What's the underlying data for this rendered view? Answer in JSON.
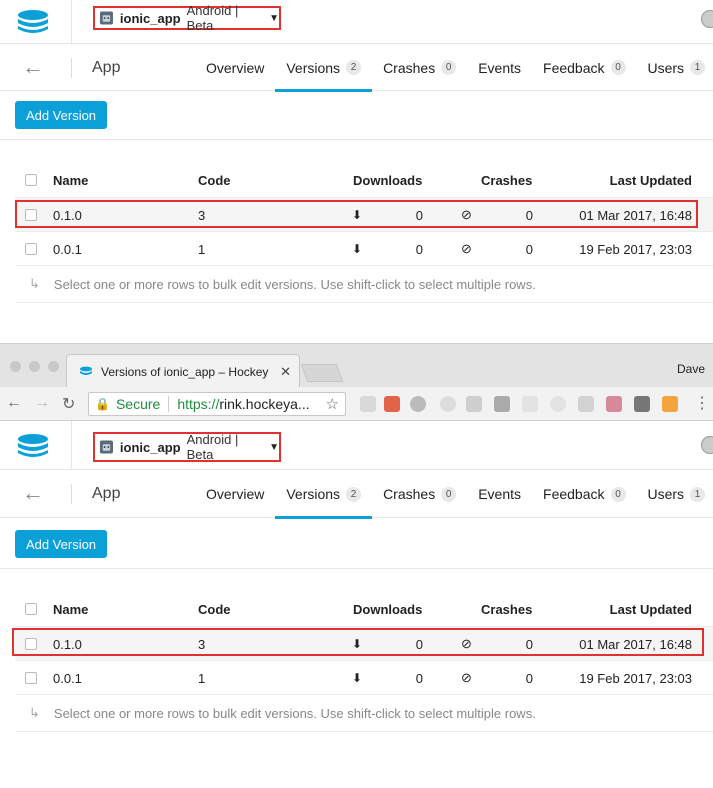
{
  "app": {
    "name": "ionic_app",
    "platform": "Android | Beta",
    "page_title": "App"
  },
  "tabs": [
    {
      "label": "Overview",
      "count": ""
    },
    {
      "label": "Versions",
      "count": "2"
    },
    {
      "label": "Crashes",
      "count": "0"
    },
    {
      "label": "Events",
      "count": ""
    },
    {
      "label": "Feedback",
      "count": "0"
    },
    {
      "label": "Users",
      "count": "1"
    }
  ],
  "add_version_label": "Add Version",
  "table": {
    "headers": {
      "name": "Name",
      "code": "Code",
      "downloads": "Downloads",
      "crashes": "Crashes",
      "last_updated": "Last Updated"
    },
    "rows": [
      {
        "name": "0.1.0",
        "code": "3",
        "downloads": "0",
        "crashes": "0",
        "last_updated": "01 Mar 2017, 16:48"
      },
      {
        "name": "0.0.1",
        "code": "1",
        "downloads": "0",
        "crashes": "0",
        "last_updated": "19 Feb 2017, 23:03"
      }
    ]
  },
  "footnote": "Select one or more rows to bulk edit versions. Use shift-click to select multiple rows.",
  "browser": {
    "tab_title": "Versions of ionic_app – Hockey",
    "profile": "Dave",
    "secure_label": "Secure",
    "url_scheme": "https://",
    "url_host": "rink.hockeya..."
  },
  "colors": {
    "accent": "#0ba0d8",
    "highlight": "#e0312f"
  }
}
